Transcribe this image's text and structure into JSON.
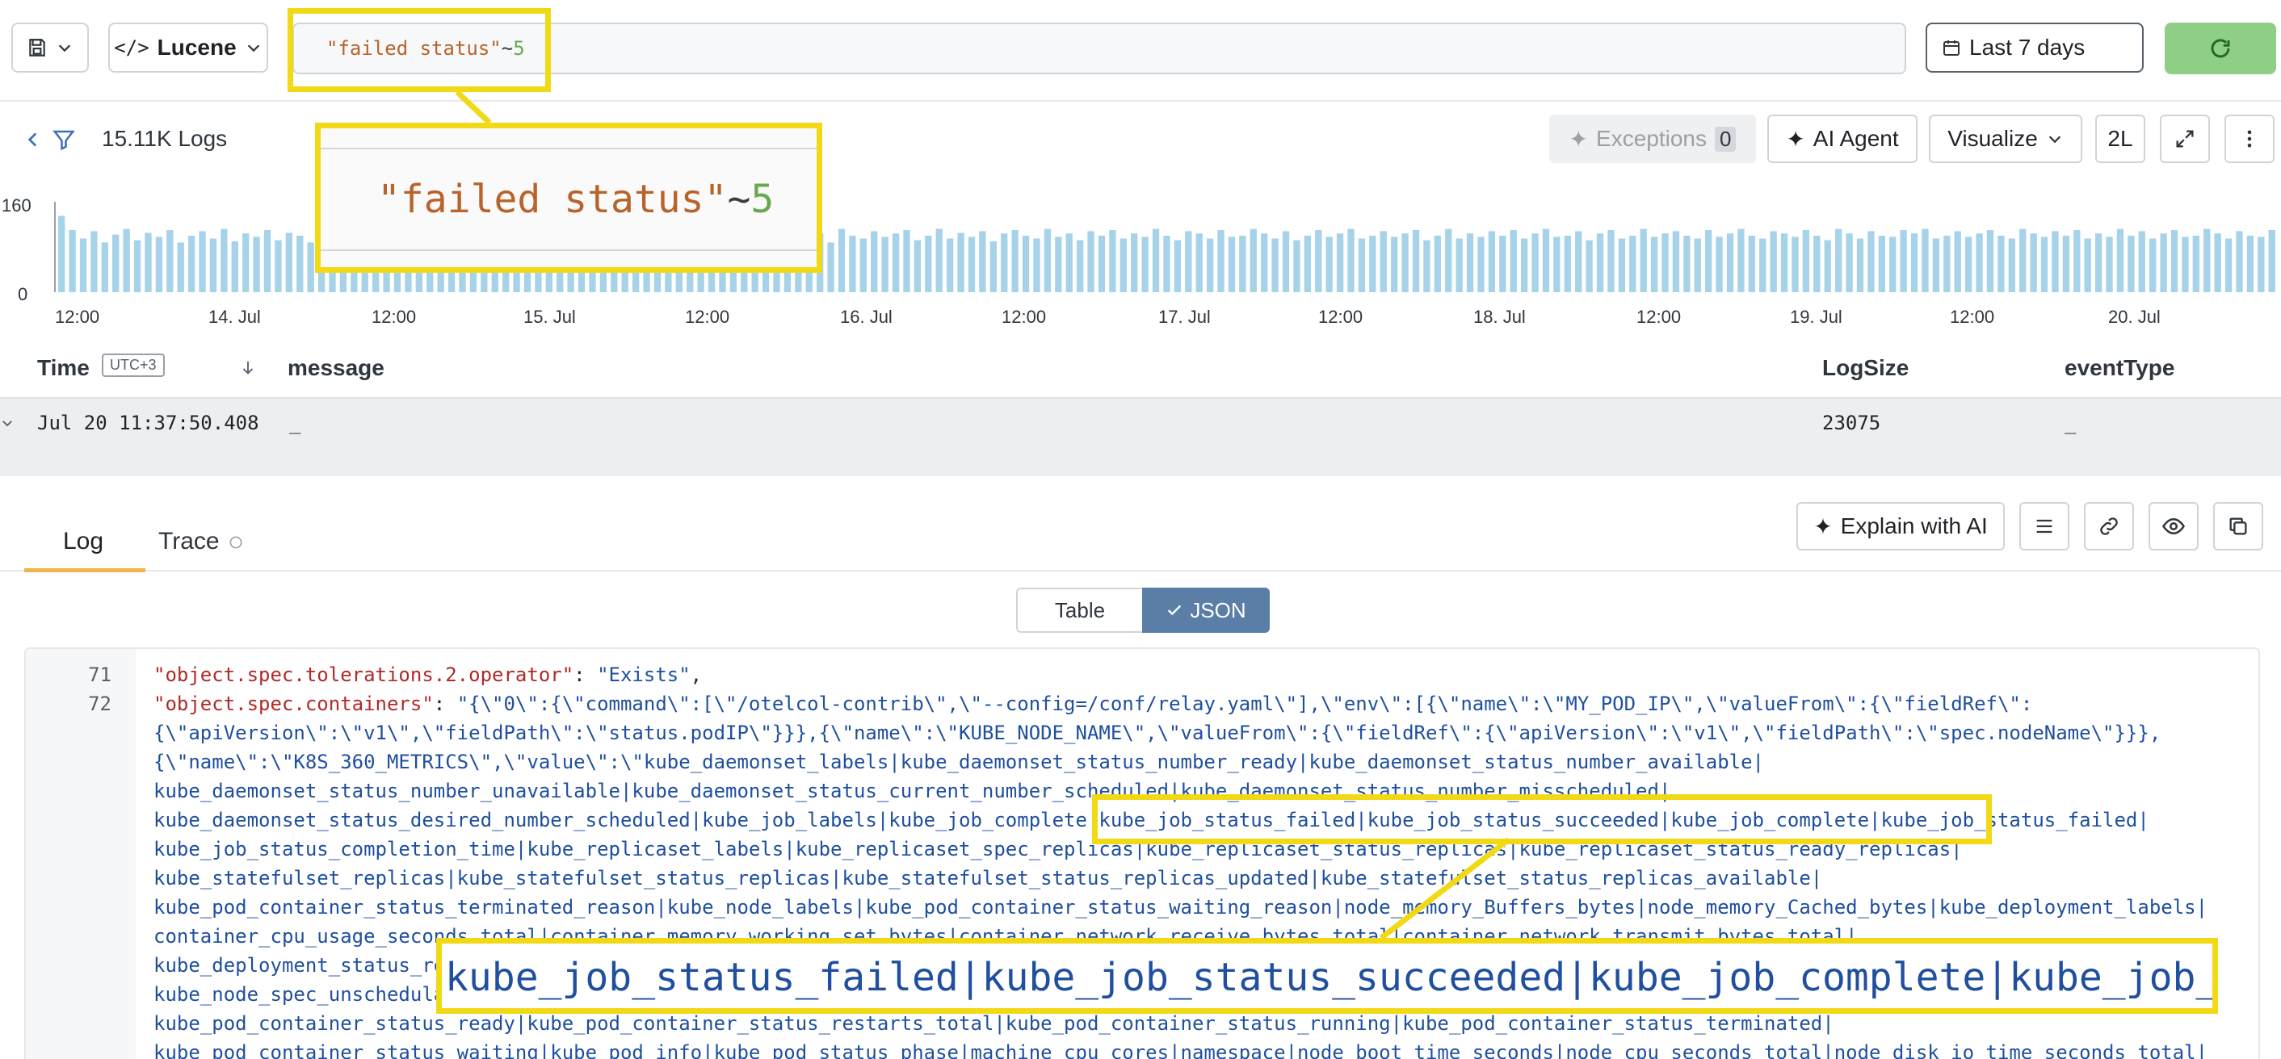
{
  "toolbar": {
    "save_icon": "save-icon",
    "query_language": "Lucene",
    "query": {
      "phrase": "\"failed status\"",
      "operator": "~",
      "distance": "5"
    },
    "time_range": "Last 7 days",
    "refresh_icon": "refresh-icon"
  },
  "logs_header": {
    "count": "15.11K Logs",
    "exceptions_label": "Exceptions",
    "exceptions_count": "0",
    "ai_agent_label": "AI Agent",
    "visualize_label": "Visualize",
    "lines_label": "2L"
  },
  "chart_data": {
    "type": "bar",
    "y_ticks": [
      "160",
      "0"
    ],
    "ylim": [
      0,
      160
    ],
    "x_ticks": [
      "12:00",
      "14. Jul",
      "12:00",
      "15. Jul",
      "12:00",
      "16. Jul",
      "12:00",
      "17. Jul",
      "12:00",
      "18. Jul",
      "12:00",
      "19. Jul",
      "12:00",
      "20. Jul"
    ],
    "values": [
      135,
      110,
      95,
      108,
      88,
      102,
      112,
      92,
      105,
      98,
      110,
      88,
      100,
      108,
      95,
      112,
      90,
      104,
      98,
      110,
      92,
      105,
      100,
      88,
      112,
      95,
      104,
      98,
      110,
      92,
      100,
      108,
      95,
      105,
      88,
      112,
      98,
      104,
      100,
      110,
      92,
      95,
      108,
      100,
      88,
      112,
      104,
      98,
      95,
      110,
      100,
      92,
      108,
      104,
      98,
      112,
      90,
      105,
      100,
      110,
      95,
      98,
      108,
      92,
      104,
      112,
      100,
      95,
      110,
      98,
      104,
      88,
      112,
      100,
      95,
      108,
      98,
      104,
      110,
      92,
      100,
      112,
      95,
      105,
      98,
      108,
      90,
      104,
      110,
      100,
      95,
      112,
      98,
      104,
      92,
      108,
      100,
      110,
      95,
      104,
      98,
      112,
      100,
      92,
      108,
      104,
      95,
      110,
      98,
      100,
      112,
      104,
      95,
      108,
      92,
      100,
      110,
      98,
      104,
      112,
      95,
      100,
      108,
      98,
      104,
      110,
      92,
      100,
      112,
      95,
      104,
      98,
      108,
      100,
      110,
      95,
      104,
      112,
      98,
      100,
      108,
      92,
      104,
      110,
      95,
      100,
      112,
      98,
      104,
      108,
      100,
      95,
      110,
      98,
      104,
      112,
      100,
      95,
      108,
      104,
      98,
      110,
      100,
      92,
      112,
      104,
      95,
      108,
      100,
      98,
      110,
      104,
      112,
      95,
      100,
      108,
      98,
      104,
      110,
      100,
      95,
      112,
      104,
      98,
      108,
      100,
      110,
      95,
      104,
      98,
      112,
      100,
      108,
      95,
      104,
      110,
      98,
      100,
      112,
      104,
      95,
      108,
      100,
      98,
      110
    ]
  },
  "table": {
    "columns": {
      "time": "Time",
      "utc": "UTC+3",
      "message": "message",
      "logsize": "LogSize",
      "eventtype": "eventType"
    },
    "row": {
      "time": "Jul 20 11:37:50.408",
      "message": "_",
      "logsize": "23075",
      "eventtype": "_"
    }
  },
  "detail": {
    "tab_log": "Log",
    "tab_trace": "Trace",
    "explain_label": "Explain with AI",
    "view_table": "Table",
    "view_json": "JSON"
  },
  "code": {
    "line_numbers": [
      "71",
      "72"
    ],
    "line71_key": "\"object.spec.tolerations.2.operator\"",
    "line71_value": "\"Exists\"",
    "line72_key": "\"object.spec.containers\"",
    "line72_parts": [
      "\"{\\\"0\\\":{\\\"command\\\":[\\\"/otelcol-contrib\\\",\\\"--config=/conf/relay.yaml\\\"],\\\"env\\\":[{\\\"name\\\":\\\"MY_POD_IP\\\",\\\"valueFrom\\\":{\\\"fieldRef\\\":",
      "{\\\"apiVersion\\\":\\\"v1\\\",\\\"fieldPath\\\":\\\"status.podIP\\\"}}},{\\\"name\\\":\\\"KUBE_NODE_NAME\\\",\\\"valueFrom\\\":{\\\"fieldRef\\\":{\\\"apiVersion\\\":\\\"v1\\\",\\\"fieldPath\\\":\\\"spec.nodeName\\\"}}},",
      "{\\\"name\\\":\\\"K8S_360_METRICS\\\",\\\"value\\\":\\\"kube_daemonset_labels|kube_daemonset_status_number_ready|kube_daemonset_status_number_available|",
      "kube_daemonset_status_number_unavailable|kube_daemonset_status_current_number_scheduled|kube_daemonset_status_number_misscheduled|",
      "kube_daemonset_status_desired_number_scheduled|kube_job_labels|kube_job_complete|kube_job_status_failed|kube_job_status_succeeded|kube_job_complete|kube_job_status_failed|",
      "kube_job_status_completion_time|kube_replicaset_labels|kube_replicaset_spec_replicas|kube_replicaset_status_replicas|kube_replicaset_status_ready_replicas|",
      "kube_statefulset_replicas|kube_statefulset_status_replicas|kube_statefulset_status_replicas_updated|kube_statefulset_status_replicas_available|",
      "kube_pod_container_status_terminated_reason|kube_node_labels|kube_pod_container_status_waiting_reason|node_memory_Buffers_bytes|node_memory_Cached_bytes|kube_deployment_labels|",
      "container_cpu_usage_seconds_total|container_memory_working_set_bytes|container_network_receive_bytes_total|container_network_transmit_bytes_total|",
      "kube_deployment_status_replicas|kube_deployment_status_replicas_available|kube_deployment_spec_replicas|kube_node_status_condition|kube_node_status_allocatable|",
      "kube_node_spec_unschedulable|kube_node_status_capacity|kube_pod_container_info|kube_pod_container_status_ready|kube_pod_container_status_running|",
      "kube_pod_container_status_ready|kube_pod_container_status_restarts_total|kube_pod_container_status_running|kube_pod_container_status_terminated|",
      "kube_pod_container_status_waiting|kube_pod_info|kube_pod_status_phase|machine_cpu_cores|namespace|node_boot_time_seconds|node_cpu_seconds_total|node_disk_io_time_seconds_total|"
    ]
  },
  "callouts": {
    "query_zoom": {
      "phrase": "\"failed status\"",
      "operator": "~",
      "distance": "5"
    },
    "json_zoom": "kube_job_status_failed|kube_job_status_succeeded|kube_job_complete|kube_job_"
  },
  "colors": {
    "accent_green": "#8fce87",
    "bar": "#a6d3e9",
    "highlight": "#f2d916",
    "tab_accent": "#f0b54a"
  }
}
